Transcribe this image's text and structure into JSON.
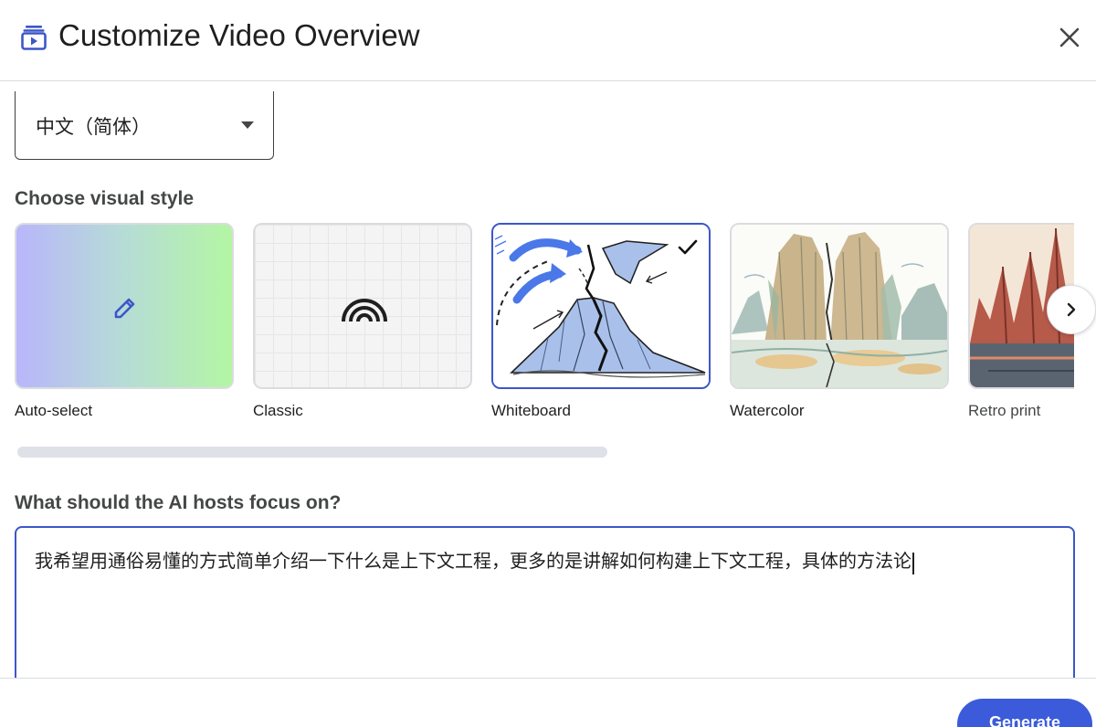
{
  "header": {
    "title": "Customize Video Overview",
    "icon": "video-overview-icon",
    "close_icon": "close-icon"
  },
  "language_select": {
    "value": "中文（简体）",
    "caret_icon": "dropdown-arrow-icon"
  },
  "visual_style": {
    "label": "Choose visual style",
    "selected": "Whiteboard",
    "cards": [
      {
        "label": "Auto-select",
        "icon": "pencil-icon"
      },
      {
        "label": "Classic",
        "icon": "rainbow-arcs-icon"
      },
      {
        "label": "Whiteboard",
        "icon": "volcano-sketch-image",
        "selected": true
      },
      {
        "label": "Watercolor",
        "icon": "watercolor-mountains-image"
      },
      {
        "label": "Retro print",
        "icon": "retro-print-image"
      }
    ],
    "next_icon": "chevron-right-icon"
  },
  "focus": {
    "label": "What should the AI hosts focus on?",
    "value": "我希望用通俗易懂的方式简单介绍一下什么是上下文工程，更多的是讲解如何构建上下文工程，具体的方法论"
  },
  "footer": {
    "generate_label": "Generate"
  },
  "colors": {
    "accent": "#3b5bdb",
    "selected_border": "#3c57c9",
    "divider": "#dadce0"
  }
}
